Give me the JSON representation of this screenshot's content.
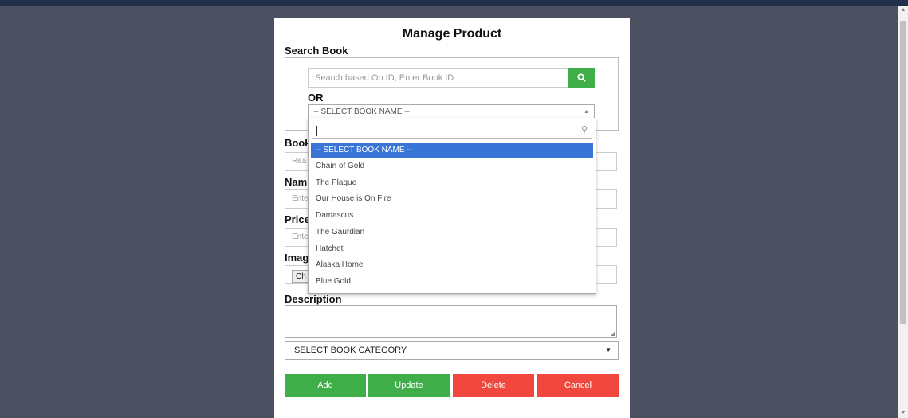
{
  "page": {
    "title": "Manage Product",
    "search_label": "Search Book",
    "search_placeholder": "Search based On ID, Enter Book ID",
    "or_label": "OR",
    "book_name_select": "-- SELECT BOOK NAME --",
    "book_options": [
      "-- SELECT BOOK NAME --",
      "Chain of Gold",
      "The Plague",
      "Our House is On Fire",
      "Damascus",
      "The Gaurdian",
      "Hatchet",
      "Alaska Home",
      "Blue Gold"
    ],
    "labels": {
      "book_id": "Book",
      "name": "Nam",
      "price": "Price",
      "image": "Imag",
      "description": "Description"
    },
    "placeholders": {
      "book_id": "Rea",
      "name": "Ente",
      "price": "Ente"
    },
    "choose_file": "Ch",
    "category": "SELECT BOOK CATEGORY",
    "buttons": {
      "add": "Add",
      "update": "Update",
      "delete": "Delete",
      "cancel": "Cancel"
    }
  }
}
